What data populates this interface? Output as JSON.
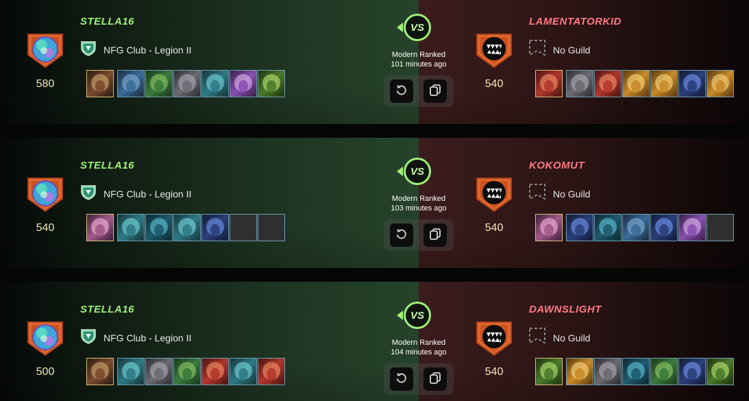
{
  "battles": [
    {
      "player": {
        "name": "STELLA16",
        "rating": "580",
        "guild": "NFG Club - Legion II"
      },
      "mode": "Modern Ranked",
      "time": "101 minutes ago",
      "opponent": {
        "name": "LAMENTATORKID",
        "rating": "540",
        "guild": "No Guild"
      },
      "vs_label": "VS"
    },
    {
      "player": {
        "name": "STELLA16",
        "rating": "540",
        "guild": "NFG Club - Legion II"
      },
      "mode": "Modern Ranked",
      "time": "103 minutes ago",
      "opponent": {
        "name": "KOKOMUT",
        "rating": "540",
        "guild": "No Guild"
      },
      "vs_label": "VS"
    },
    {
      "player": {
        "name": "STELLA16",
        "rating": "500",
        "guild": "NFG Club - Legion II"
      },
      "mode": "Modern Ranked",
      "time": "104 minutes ago",
      "opponent": {
        "name": "DAWNSLIGHT",
        "rating": "540",
        "guild": "No Guild"
      },
      "vs_label": "VS"
    }
  ],
  "icons": {
    "replay": "replay-icon",
    "copy": "copy-icon",
    "guild_shield": "shield-icon",
    "no_guild": "empty-flag-icon",
    "player_badge": "bronze-rank-badge-icon",
    "opponent_badge": "monster-rank-badge-icon"
  },
  "colors": {
    "player_name": "#9ff07a",
    "opponent_name": "#ff7a84",
    "rating": "#f3e7b5",
    "vs_ring": "#9ff07a",
    "badge": "#e2662f"
  }
}
